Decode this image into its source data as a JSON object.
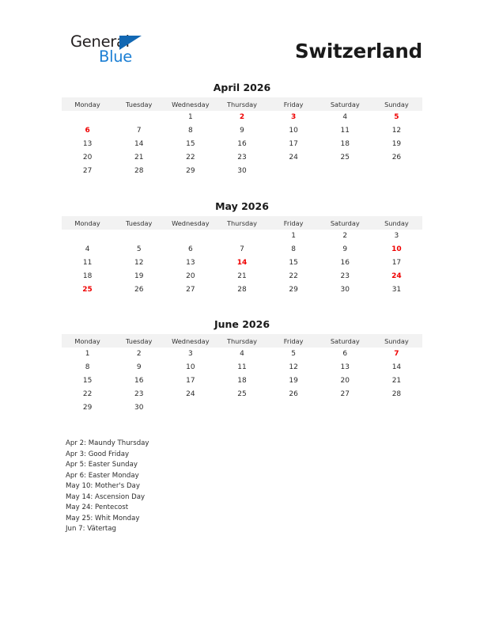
{
  "brand": {
    "name_part1": "General",
    "name_part2": "Blue",
    "logo_icon": "triangle-icon",
    "color_dark": "#231f20",
    "color_blue": "#1c7fd4",
    "color_triangle": "#1268b3"
  },
  "page_title": "Switzerland",
  "colors": {
    "holiday_red": "#ef0000",
    "header_band": "#f2f2f2",
    "text": "#2b2b2b"
  },
  "weekday_headers": [
    "Monday",
    "Tuesday",
    "Wednesday",
    "Thursday",
    "Friday",
    "Saturday",
    "Sunday"
  ],
  "months": [
    {
      "title": "April 2026",
      "weeks": [
        [
          {
            "d": "",
            "h": false
          },
          {
            "d": "",
            "h": false
          },
          {
            "d": "1",
            "h": false
          },
          {
            "d": "2",
            "h": true
          },
          {
            "d": "3",
            "h": true
          },
          {
            "d": "4",
            "h": false
          },
          {
            "d": "5",
            "h": true
          }
        ],
        [
          {
            "d": "6",
            "h": true
          },
          {
            "d": "7",
            "h": false
          },
          {
            "d": "8",
            "h": false
          },
          {
            "d": "9",
            "h": false
          },
          {
            "d": "10",
            "h": false
          },
          {
            "d": "11",
            "h": false
          },
          {
            "d": "12",
            "h": false
          }
        ],
        [
          {
            "d": "13",
            "h": false
          },
          {
            "d": "14",
            "h": false
          },
          {
            "d": "15",
            "h": false
          },
          {
            "d": "16",
            "h": false
          },
          {
            "d": "17",
            "h": false
          },
          {
            "d": "18",
            "h": false
          },
          {
            "d": "19",
            "h": false
          }
        ],
        [
          {
            "d": "20",
            "h": false
          },
          {
            "d": "21",
            "h": false
          },
          {
            "d": "22",
            "h": false
          },
          {
            "d": "23",
            "h": false
          },
          {
            "d": "24",
            "h": false
          },
          {
            "d": "25",
            "h": false
          },
          {
            "d": "26",
            "h": false
          }
        ],
        [
          {
            "d": "27",
            "h": false
          },
          {
            "d": "28",
            "h": false
          },
          {
            "d": "29",
            "h": false
          },
          {
            "d": "30",
            "h": false
          },
          {
            "d": "",
            "h": false
          },
          {
            "d": "",
            "h": false
          },
          {
            "d": "",
            "h": false
          }
        ]
      ]
    },
    {
      "title": "May 2026",
      "weeks": [
        [
          {
            "d": "",
            "h": false
          },
          {
            "d": "",
            "h": false
          },
          {
            "d": "",
            "h": false
          },
          {
            "d": "",
            "h": false
          },
          {
            "d": "1",
            "h": false
          },
          {
            "d": "2",
            "h": false
          },
          {
            "d": "3",
            "h": false
          }
        ],
        [
          {
            "d": "4",
            "h": false
          },
          {
            "d": "5",
            "h": false
          },
          {
            "d": "6",
            "h": false
          },
          {
            "d": "7",
            "h": false
          },
          {
            "d": "8",
            "h": false
          },
          {
            "d": "9",
            "h": false
          },
          {
            "d": "10",
            "h": true
          }
        ],
        [
          {
            "d": "11",
            "h": false
          },
          {
            "d": "12",
            "h": false
          },
          {
            "d": "13",
            "h": false
          },
          {
            "d": "14",
            "h": true
          },
          {
            "d": "15",
            "h": false
          },
          {
            "d": "16",
            "h": false
          },
          {
            "d": "17",
            "h": false
          }
        ],
        [
          {
            "d": "18",
            "h": false
          },
          {
            "d": "19",
            "h": false
          },
          {
            "d": "20",
            "h": false
          },
          {
            "d": "21",
            "h": false
          },
          {
            "d": "22",
            "h": false
          },
          {
            "d": "23",
            "h": false
          },
          {
            "d": "24",
            "h": true
          }
        ],
        [
          {
            "d": "25",
            "h": true
          },
          {
            "d": "26",
            "h": false
          },
          {
            "d": "27",
            "h": false
          },
          {
            "d": "28",
            "h": false
          },
          {
            "d": "29",
            "h": false
          },
          {
            "d": "30",
            "h": false
          },
          {
            "d": "31",
            "h": false
          }
        ]
      ]
    },
    {
      "title": "June 2026",
      "weeks": [
        [
          {
            "d": "1",
            "h": false
          },
          {
            "d": "2",
            "h": false
          },
          {
            "d": "3",
            "h": false
          },
          {
            "d": "4",
            "h": false
          },
          {
            "d": "5",
            "h": false
          },
          {
            "d": "6",
            "h": false
          },
          {
            "d": "7",
            "h": true
          }
        ],
        [
          {
            "d": "8",
            "h": false
          },
          {
            "d": "9",
            "h": false
          },
          {
            "d": "10",
            "h": false
          },
          {
            "d": "11",
            "h": false
          },
          {
            "d": "12",
            "h": false
          },
          {
            "d": "13",
            "h": false
          },
          {
            "d": "14",
            "h": false
          }
        ],
        [
          {
            "d": "15",
            "h": false
          },
          {
            "d": "16",
            "h": false
          },
          {
            "d": "17",
            "h": false
          },
          {
            "d": "18",
            "h": false
          },
          {
            "d": "19",
            "h": false
          },
          {
            "d": "20",
            "h": false
          },
          {
            "d": "21",
            "h": false
          }
        ],
        [
          {
            "d": "22",
            "h": false
          },
          {
            "d": "23",
            "h": false
          },
          {
            "d": "24",
            "h": false
          },
          {
            "d": "25",
            "h": false
          },
          {
            "d": "26",
            "h": false
          },
          {
            "d": "27",
            "h": false
          },
          {
            "d": "28",
            "h": false
          }
        ],
        [
          {
            "d": "29",
            "h": false
          },
          {
            "d": "30",
            "h": false
          },
          {
            "d": "",
            "h": false
          },
          {
            "d": "",
            "h": false
          },
          {
            "d": "",
            "h": false
          },
          {
            "d": "",
            "h": false
          },
          {
            "d": "",
            "h": false
          }
        ]
      ]
    }
  ],
  "holidays": [
    "Apr 2: Maundy Thursday",
    "Apr 3: Good Friday",
    "Apr 5: Easter Sunday",
    "Apr 6: Easter Monday",
    "May 10: Mother's Day",
    "May 14: Ascension Day",
    "May 24: Pentecost",
    "May 25: Whit Monday",
    "Jun 7: Vätertag"
  ]
}
